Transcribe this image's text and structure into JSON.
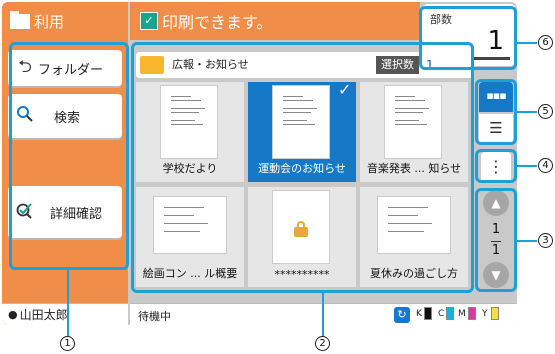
{
  "mode": {
    "title": "利用"
  },
  "left_buttons": [
    {
      "icon": "back-arrow-icon",
      "label": "フォルダー"
    },
    {
      "icon": "search-icon",
      "label": "検索"
    },
    {
      "icon": "detail-check-icon",
      "label": "詳細確認"
    }
  ],
  "header": {
    "message": "印刷できます。",
    "check_glyph": "✓"
  },
  "copies": {
    "label": "部数",
    "value": "1"
  },
  "folder_bar": {
    "folder_name": "広報・お知らせ",
    "select_label": "選択数",
    "select_count": "1"
  },
  "thumbnails": [
    {
      "caption": "学校だより",
      "selected": false,
      "locked": false
    },
    {
      "caption": "運動会のお知らせ",
      "selected": true,
      "locked": false
    },
    {
      "caption": "音楽発表 ... 知らせ",
      "selected": false,
      "locked": false
    },
    {
      "caption": "絵画コン ... ル概要",
      "selected": false,
      "locked": false
    },
    {
      "caption": "**********",
      "selected": false,
      "locked": true
    },
    {
      "caption": "夏休みの過ごし方",
      "selected": false,
      "locked": false
    }
  ],
  "side": {
    "view_thumbnail_glyph": "▪▪▪",
    "view_list_glyph": "☰",
    "more_glyph": "⋮"
  },
  "pager": {
    "current": "1",
    "total": "1"
  },
  "user": {
    "name": "山田太郎"
  },
  "status": {
    "text": "待機中",
    "inks": [
      {
        "letter": "K",
        "color": "#111111"
      },
      {
        "letter": "C",
        "color": "#16b0e6"
      },
      {
        "letter": "M",
        "color": "#e0389a"
      },
      {
        "letter": "Y",
        "color": "#f2e03c"
      }
    ]
  },
  "callouts": [
    "1",
    "2",
    "3",
    "4",
    "5",
    "6"
  ],
  "colors": {
    "accent_orange": "#f08d49",
    "selection_blue": "#1579c8",
    "callout_blue": "#1e9fd8"
  }
}
